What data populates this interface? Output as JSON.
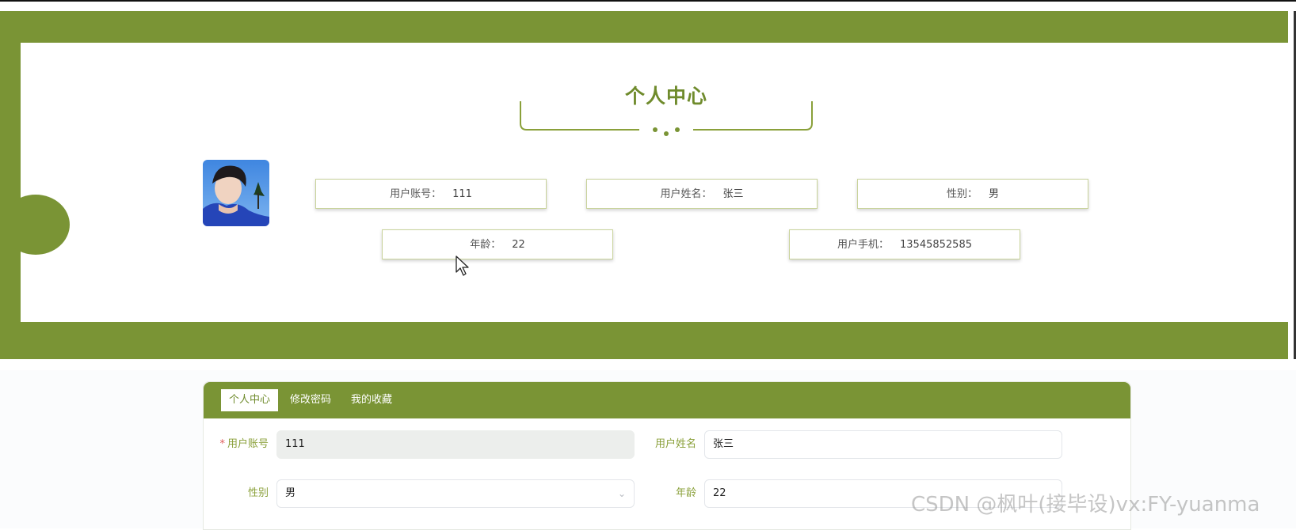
{
  "hero": {
    "title": "个人中心",
    "cards": [
      {
        "label": "用户账号：",
        "value": "111"
      },
      {
        "label": "用户姓名：",
        "value": "张三"
      },
      {
        "label": "性别：",
        "value": "男"
      },
      {
        "label": "年龄：",
        "value": "22"
      },
      {
        "label": "用户手机：",
        "value": "13545852585"
      }
    ]
  },
  "tabs": [
    {
      "label": "个人中心",
      "active": true
    },
    {
      "label": "修改密码",
      "active": false
    },
    {
      "label": "我的收藏",
      "active": false
    }
  ],
  "form": {
    "required_mark": "*",
    "account_label": "用户账号",
    "account_value": "111",
    "name_label": "用户姓名",
    "name_value": "张三",
    "gender_label": "性别",
    "gender_value": "男",
    "age_label": "年龄",
    "age_value": "22"
  },
  "watermark": "CSDN @枫叶(接毕设)vx:FY-yuanma",
  "colors": {
    "brand": "#7a9435",
    "title": "#6f8b2c"
  },
  "icons": {
    "select": "chevron-down-icon",
    "cursor": "mouse-cursor-icon"
  }
}
